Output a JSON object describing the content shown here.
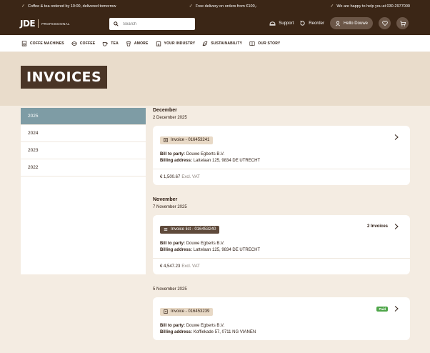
{
  "topbar": {
    "usp1": "Coffee & tea ordered by 10:00, delivered tomorrow",
    "usp2": "Free delivery on orders from €100,-",
    "usp3": "We are happy to help you at 030-2977000"
  },
  "header": {
    "logo_text": "JDE",
    "logo_sub": "PROFESSIONAL",
    "search_placeholder": "Search",
    "support": "Support",
    "reorder": "Reorder",
    "hello": "Hello Douwe"
  },
  "nav": {
    "items": [
      {
        "label": "COFFE MACHINES",
        "icon": "coffee-machine-icon"
      },
      {
        "label": "COFFEE",
        "icon": "coffee-bean-icon"
      },
      {
        "label": "TEA",
        "icon": "tea-cup-icon"
      },
      {
        "label": "AMORE",
        "icon": "cup-icon"
      },
      {
        "label": "YOUR INDUSTRY",
        "icon": "building-icon"
      },
      {
        "label": "SUSTAINABILITY",
        "icon": "leaf-icon"
      },
      {
        "label": "OUR STORY",
        "icon": "book-icon"
      }
    ]
  },
  "page": {
    "title": "INVOICES"
  },
  "years": [
    "2025",
    "2024",
    "2023",
    "2022"
  ],
  "groups": [
    {
      "month": "December",
      "date": "2 December 2025",
      "invoice": {
        "tag": "Invoice - 016453241",
        "bill_label": "Bill to party:",
        "bill_value": "Douwe Egberts B.V.",
        "addr_label": "Billing address:",
        "addr_value": "Lattelaan 125, 9834 DE UTRECHT",
        "amount": "€ 1,500.67",
        "vat": "Excl. VAT"
      }
    },
    {
      "month": "November",
      "date": "7 November 2025",
      "invoice": {
        "tag": "Invoice list - 016453240",
        "count": "2 Invoices",
        "bill_label": "Bill to party:",
        "bill_value": "Douwe Egberts B.V.",
        "addr_label": "Billing address:",
        "addr_value": "Lattelaan 125, 9834 DE UTRECHT",
        "amount": "€ 4,547.23",
        "vat": "Excl. VAT"
      }
    },
    {
      "date": "5 November 2025",
      "invoice": {
        "tag": "Invoice - 016453239",
        "status": "Paid",
        "bill_label": "Bill to party:",
        "bill_value": "Douwe Egberts B.V.",
        "addr_label": "Billing address:",
        "addr_value": "Koffiekade 57, 0711 NG VIANEN"
      }
    }
  ],
  "colors": {
    "brand_dark": "#3b2616",
    "active_year": "#7e9ca5",
    "paid_badge": "#4fa64a"
  }
}
